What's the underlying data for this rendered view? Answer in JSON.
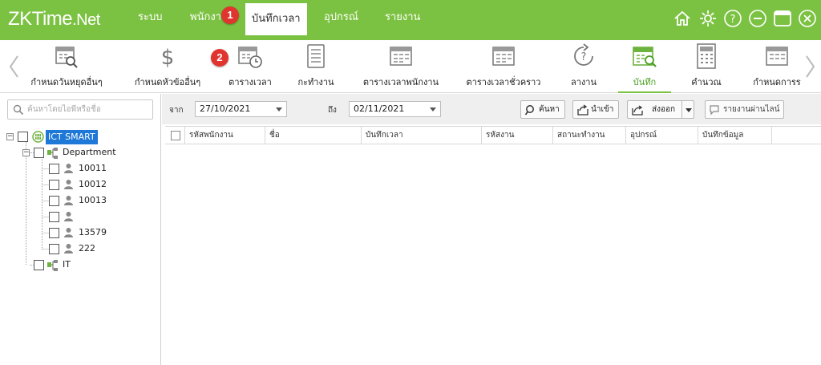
{
  "app": {
    "logo_main": "ZKTime",
    "logo_suffix": ".Net"
  },
  "menu": [
    {
      "label": "ระบบ"
    },
    {
      "label": "พนักงา"
    },
    {
      "label": "บันทึกเวลา",
      "active": true
    },
    {
      "label": "อุปกรณ์"
    },
    {
      "label": "รายงาน"
    }
  ],
  "badges": {
    "b1": "1",
    "b2": "2"
  },
  "window_icons": [
    "home-icon",
    "gear-icon",
    "help-icon",
    "minimize-icon",
    "maximize-icon",
    "close-icon"
  ],
  "toolbar": [
    {
      "label": "กำหนดวันหยุดอื่นๆ",
      "icon": "holiday-search-icon"
    },
    {
      "label": "กำหนดหัวข้ออื่นๆ",
      "icon": "dollar-icon"
    },
    {
      "label": "ตารางเวลา",
      "icon": "timetable-icon"
    },
    {
      "label": "กะทำงาน",
      "icon": "shift-list-icon"
    },
    {
      "label": "ตารางเวลาพนักงาน",
      "icon": "employee-schedule-icon"
    },
    {
      "label": "ตารางเวลาชั่วคราว",
      "icon": "temp-schedule-icon"
    },
    {
      "label": "ลางาน",
      "icon": "leave-icon"
    },
    {
      "label": "บันทึก",
      "icon": "record-calendar-icon",
      "active": true
    },
    {
      "label": "คำนวณ",
      "icon": "calculator-icon"
    },
    {
      "label": "กำหนดการร",
      "icon": "schedule-rules-icon"
    }
  ],
  "search": {
    "placeholder": "ค้นหาโดยไอพีหรือชื่อ"
  },
  "tree": {
    "root": "ICT SMART",
    "department": "Department",
    "employees": [
      "10011",
      "10012",
      "10013",
      "",
      "13579",
      "222"
    ],
    "it": "IT"
  },
  "filter": {
    "from_label": "จาก",
    "from_date": "27/10/2021",
    "to_label": "ถึง",
    "to_date": "02/11/2021",
    "search_btn": "ค้นหา",
    "import_btn": "นำเข้า",
    "export_btn": "ส่งออก",
    "online_report_btn": "รายงานผ่านไลน์"
  },
  "table": {
    "columns": [
      "รหัสพนักงาน",
      "ชื่อ",
      "บันทึกเวลา",
      "รหัสงาน",
      "สถานะทำงาน",
      "อุปกรณ์",
      "บันทึกข้อมูล"
    ]
  },
  "colors": {
    "accent": "#7cc242",
    "badge": "#e0352f",
    "selected": "#1e78d7"
  }
}
